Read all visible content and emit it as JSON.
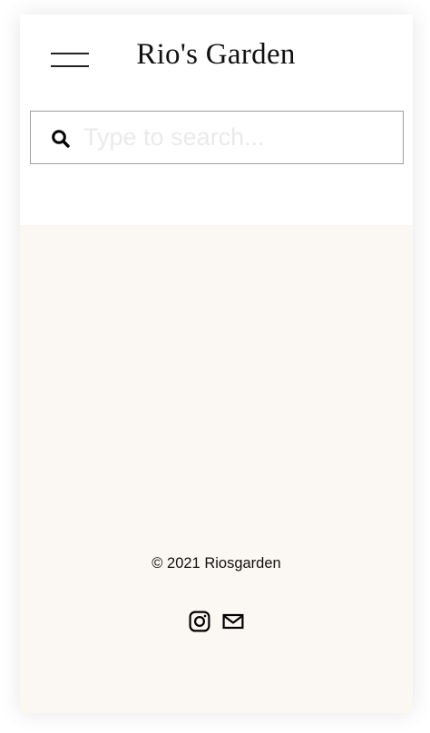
{
  "header": {
    "site_title": "Rio's Garden",
    "menu_icon": "hamburger-menu-icon"
  },
  "search": {
    "icon": "search-icon",
    "placeholder": "Type to search...",
    "value": ""
  },
  "footer": {
    "copyright": "© 2021 Riosgarden",
    "social": [
      {
        "icon": "instagram-icon"
      },
      {
        "icon": "mail-icon"
      }
    ]
  },
  "colors": {
    "header_bg": "#ffffff",
    "content_bg": "#fbf7f3",
    "text": "#111111",
    "search_border": "#9e9e9e",
    "placeholder": "#eaeaea"
  }
}
